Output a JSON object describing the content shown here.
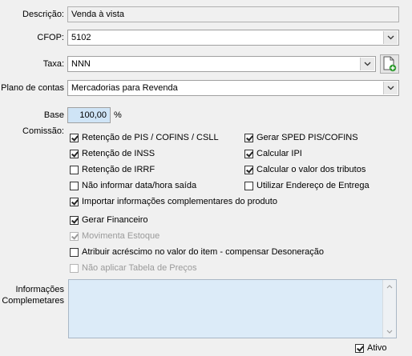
{
  "form": {
    "descricao": {
      "label": "Descrição:",
      "value": "Venda à vista"
    },
    "cfop": {
      "label": "CFOP:",
      "value": "5102"
    },
    "taxa": {
      "label": "Taxa:",
      "value": "NNN"
    },
    "plano": {
      "label": "Plano de contas",
      "value": "Mercadorias para Revenda"
    },
    "comissao": {
      "label": "Base Comissão:",
      "value": "100,00",
      "unit": "%"
    }
  },
  "checkboxes": {
    "retencao_pis": {
      "label": "Retenção de PIS / COFINS / CSLL",
      "checked": true
    },
    "retencao_inss": {
      "label": "Retenção de INSS",
      "checked": true
    },
    "retencao_irrf": {
      "label": "Retenção de IRRF",
      "checked": false
    },
    "nao_informar_data": {
      "label": "Não informar data/hora saída",
      "checked": false
    },
    "gerar_sped": {
      "label": "Gerar SPED PIS/COFINS",
      "checked": true
    },
    "calcular_ipi": {
      "label": "Calcular IPI",
      "checked": true
    },
    "calcular_tributos": {
      "label": "Calcular o valor dos tributos",
      "checked": true
    },
    "utilizar_endereco": {
      "label": "Utilizar Endereço de Entrega",
      "checked": false
    },
    "importar_info": {
      "label": "Importar informações complementares do produto",
      "checked": true
    },
    "gerar_financeiro": {
      "label": "Gerar Financeiro",
      "checked": true
    },
    "movimenta_estoque": {
      "label": "Movimenta Estoque",
      "checked": true,
      "disabled": true
    },
    "atribuir_acrescimo": {
      "label": "Atribuir acréscimo no valor do item - compensar Desoneração",
      "checked": false
    },
    "nao_aplicar_tabela": {
      "label": "Não aplicar Tabela de Preços",
      "checked": false,
      "disabled": true
    },
    "ativo": {
      "label": "Ativo",
      "checked": true
    }
  },
  "info": {
    "label_line1": "Informações",
    "label_line2": "Complemetares",
    "value": ""
  },
  "icons": {
    "combo": "chevron-down-icon",
    "new_doc": "new-document-icon",
    "scroll_up": "scroll-up-arrow-icon",
    "scroll_down": "scroll-down-arrow-icon"
  },
  "colors": {
    "background": "#f0f0f0",
    "commission_field": "#cfe4f6",
    "memo_field": "#dcebf8",
    "add_badge": "#2e9a2e"
  }
}
